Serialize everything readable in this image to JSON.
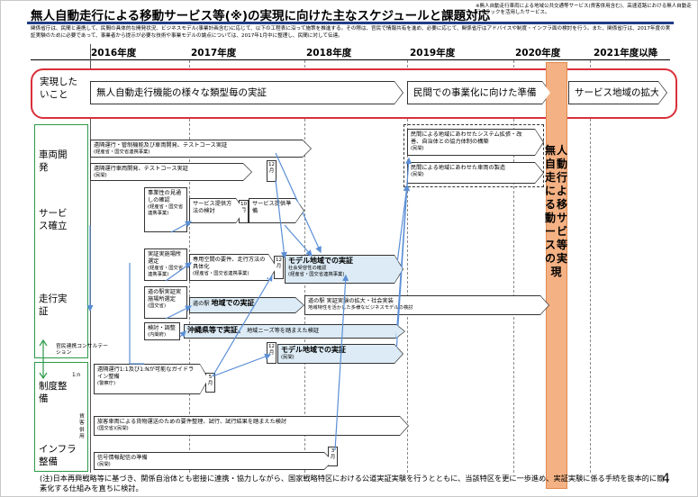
{
  "title": "無人自動走行による移動サービス等(※)の実現に向けた主なスケジュールと課題対応",
  "note": "※無人自動走行車両による地域公共交通等サービス(貨客併用含む)、高速道路における無人自動走行トラックを活用したサービス。",
  "intro": "関係省庁は、民間と連携して、民間の具体的な開発状況、ビジネスモデル(事業計画含む)に応じて、以下の工程表に沿って施策を推進する。その際は、官民で情報共有を進め、必要に応じて、関係省庁はアドバイスや制度・インフラ面の検討を行う。また、関係省庁は、2017年度の実証実験のために必要であって、事業者から提示が必要な技術や事業モデルの論点については、2017年1月中に整理し、民間に対して伝達。",
  "years": [
    "2016年度",
    "2017年度",
    "2018年度",
    "2019年度",
    "2020年度",
    "2021年度以降"
  ],
  "goal": {
    "label": "実現したいこと",
    "arrows": [
      "無人自動走行機能の様々な類型毎の実証",
      "民間での事業化に向けた準備",
      "サービス地域の拡大"
    ]
  },
  "categories": {
    "vehicle": "車両開発",
    "service": "サービス確立",
    "run": "走行実証",
    "system": "制度整備",
    "infra": "インフラ整備"
  },
  "side_labels": {
    "consult": "官民連携コンサルテーション",
    "one_n": "1:n",
    "freight": "貨客併用"
  },
  "center_vertical": "無人自動走行による移動サービス等の実現",
  "boxes": {
    "remote_test": {
      "main": "遠隔運行・管制機能及び車両開発、テストコース実証",
      "sub": "(経産省・国交省連携事業)"
    },
    "remote_vehicle": {
      "main": "遠隔運行車両開発、テストコース実証",
      "sub": "(民間)"
    },
    "demand": {
      "main": "事業性の見通しの確認",
      "sub": "(経産省・国交省連携事業)"
    },
    "service_method": {
      "main": "サービス提供方法の検討"
    },
    "service_prep": {
      "main": "サービス提供準備"
    },
    "site_select1": {
      "main": "実証実施場所選定",
      "sub": "(経産省・国交省連携事業)"
    },
    "private_road": {
      "main": "専用空間の要件、走行方法の具体化",
      "sub": "(経産省・国交省連携事業)"
    },
    "model_region1": {
      "main": "モデル地域での実証",
      "sub1": "社会受容性の確認",
      "sub2": "(経産省・国交省連携事業)"
    },
    "site_select2": {
      "main": "道の駅実証実施場所選定",
      "sub": "(国交省)"
    },
    "michinoeki": {
      "pre": "道の駅",
      "main": "地域での実証"
    },
    "expansion": {
      "main": "道の駅 実証実験の拡大・社会実装",
      "sub": "地域特性を活かした多様なビジネスモデルの検討"
    },
    "study": {
      "main": "検討・調整",
      "sub": "(内閣府)"
    },
    "okinawa": {
      "main": "沖縄県等で実証、",
      "sub": "地域ニーズ等を踏まえた検証"
    },
    "model_region2": {
      "main": "モデル地域での実証",
      "sub": "(民間)"
    },
    "guideline": {
      "main": "遠隔運行1:1及び1:Nが可能なガイドライン整備",
      "sub": "(警察庁)"
    },
    "cargo": {
      "main": "旅客車両による貨物運送のための要件整理、試行、試行結果を踏まえた検討",
      "sub": "(国交省)(民間)"
    },
    "signal": {
      "main": "信号情報配信の準備",
      "sub": "(民間)"
    },
    "region_system": {
      "main": "民間による地域にあわせたシステム拡張・改善、自治体との協力体制の構築",
      "sub": "(民間)"
    },
    "region_vehicle": {
      "main": "民間による地域にあわせた車両の製造",
      "sub": "(民間)"
    }
  },
  "months": {
    "m12a": "12月",
    "m10": "10月",
    "m12b": "12月",
    "m5": "5月",
    "m12c": "12月",
    "m3": "3月"
  },
  "footnote": "(注)日本再興戦略等に基づき、関係自治体とも密接に連携・協力しながら、国家戦略特区における公道実証実験を行うとともに、当該特区を更に一歩進め、実証実験に係る手続を抜本的に簡素化する仕組みを直ちに検討。",
  "page_number": "4",
  "colors": {
    "title_rule": "#1f3c88",
    "goal_border": "#d9303a",
    "orange": "#f4b183",
    "green": "#2b9a48",
    "blue_fill": "#dcebf5",
    "link_arrow": "#5b8fd6"
  }
}
